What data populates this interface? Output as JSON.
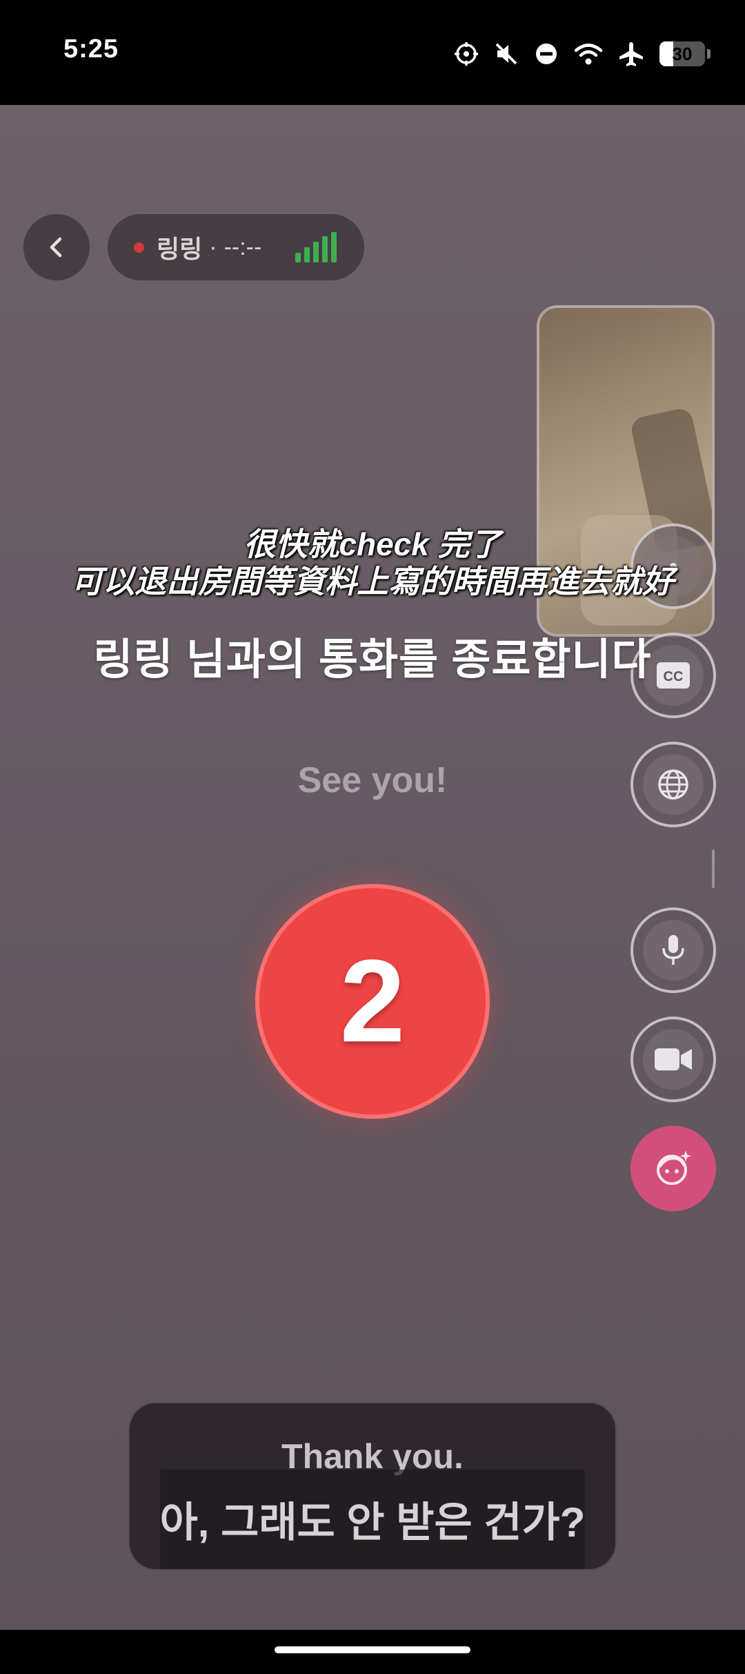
{
  "status_bar": {
    "time": "5:25",
    "battery": "30"
  },
  "call_header": {
    "name": "링링",
    "separator": "·",
    "timer": "--:--"
  },
  "subtitles": {
    "cn_line1": "很快就check 完了",
    "cn_line2": "可以退出房間等資料上寫的時間再進去就好"
  },
  "call_end_message": "링링 님과의 통화를 종료합니다",
  "farewell": "See you!",
  "countdown": "2",
  "caption": {
    "english": "Thank you.",
    "korean": "아, 그래도 안 받은 건가?"
  },
  "side_buttons": [
    "flip-camera-icon",
    "cc-icon",
    "globe-icon",
    "microphone-icon",
    "video-camera-icon",
    "avatar-face-icon"
  ],
  "colors": {
    "countdown": "#ef4444",
    "signal": "#3fae4f",
    "avatar_button": "#d34f7b",
    "rec_dot": "#d4393d"
  }
}
